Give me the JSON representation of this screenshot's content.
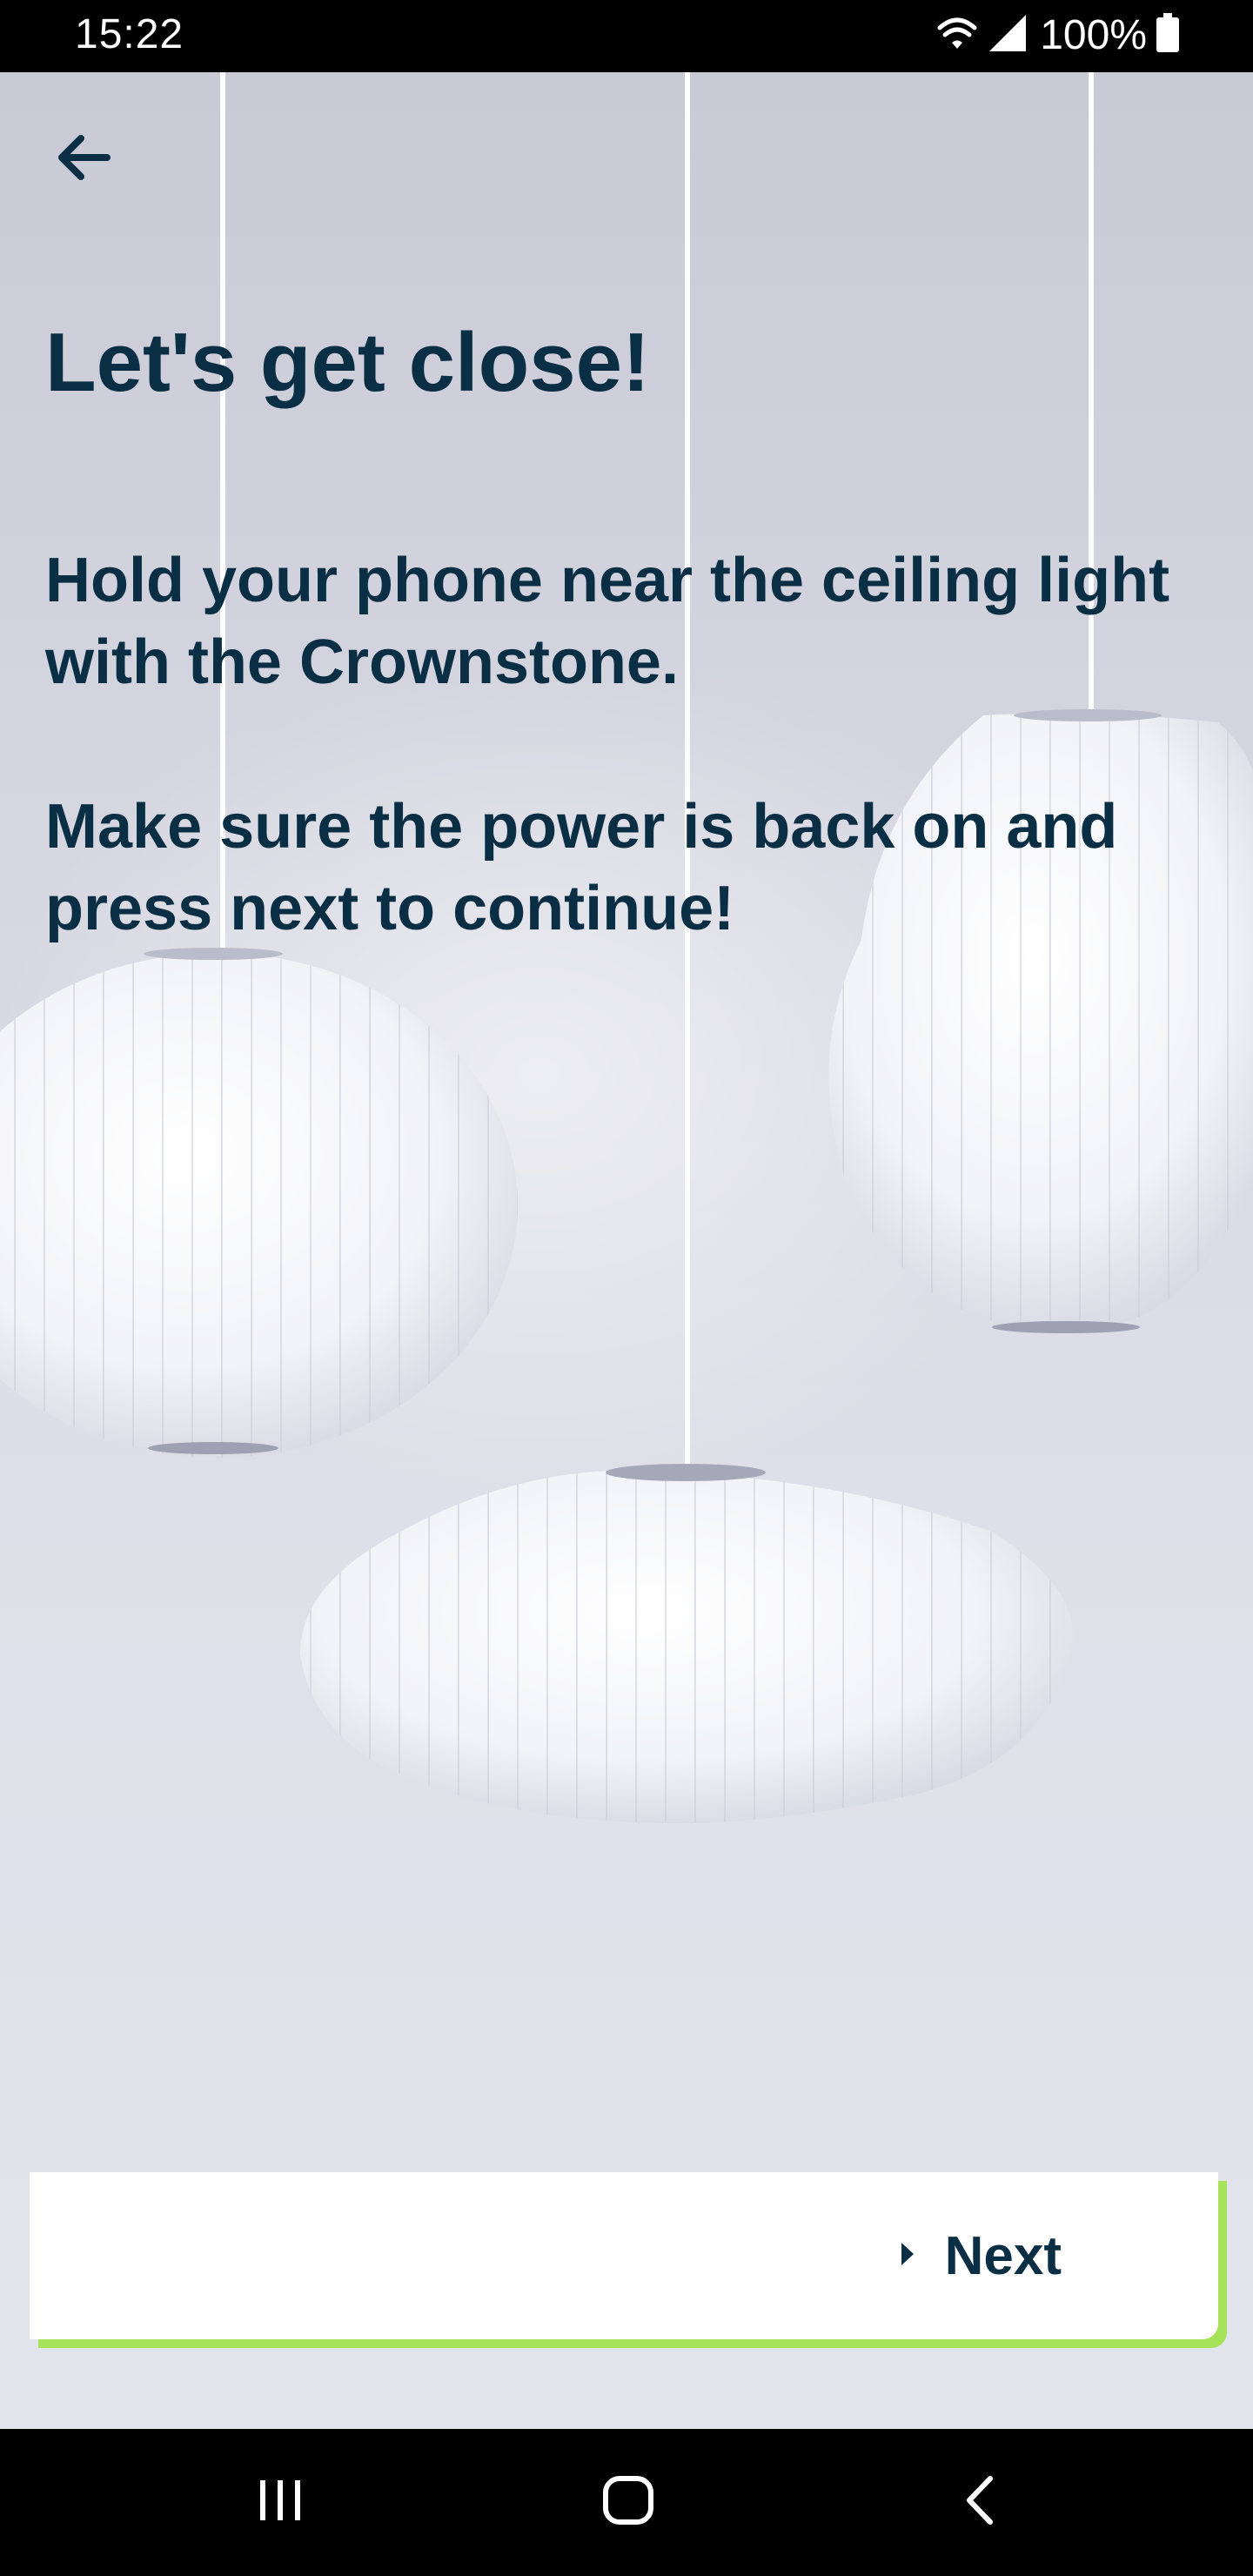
{
  "status_bar": {
    "time": "15:22",
    "battery_percent": "100%",
    "icons": [
      "wifi-icon",
      "cellular-signal-icon",
      "battery-icon"
    ]
  },
  "header": {
    "back_icon": "arrow-left-icon"
  },
  "content": {
    "title": "Let's get close!",
    "paragraph_1": "Hold your phone near the ceiling light with the Crownstone.",
    "paragraph_2": "Make sure the power is back on and press next to continue!"
  },
  "next_button": {
    "label": "Next",
    "icon": "caret-right-icon",
    "accent_color": "#a6e35a"
  },
  "nav_bar": {
    "buttons": [
      "recents-icon",
      "home-icon",
      "back-icon"
    ]
  },
  "colors": {
    "text_primary": "#0a2f45",
    "accent": "#a6e35a"
  }
}
